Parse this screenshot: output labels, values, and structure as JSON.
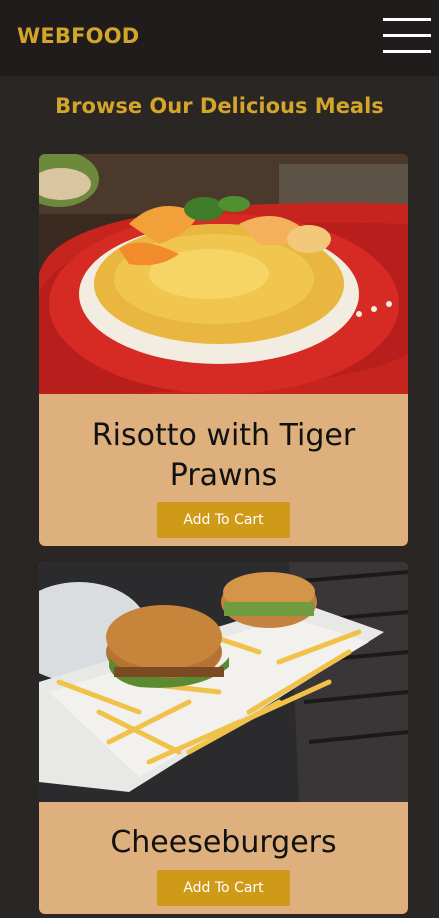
{
  "header": {
    "brand": "WEBFOOD",
    "menu_icon": "hamburger-menu-icon"
  },
  "main": {
    "title": "Browse Our Delicious Meals",
    "meals": [
      {
        "name": "Risotto with Tiger Prawns",
        "button_label": "Add To Cart",
        "image": "risotto-photo"
      },
      {
        "name": "Cheeseburgers",
        "button_label": "Add To Cart",
        "image": "cheeseburgers-photo"
      }
    ]
  },
  "colors": {
    "header_bg": "#1f1c1b",
    "page_bg": "#2a2624",
    "accent": "#d3a52b",
    "card_bg": "#ddb07d",
    "button_bg": "#cf9a17"
  }
}
